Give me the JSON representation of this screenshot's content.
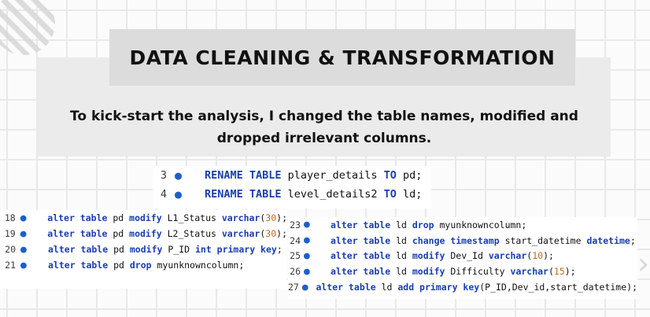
{
  "title": "DATA CLEANING & TRANSFORMATION",
  "subtitle_line1": "To kick-start the analysis, I changed the table names, modified and",
  "subtitle_line2": "dropped irrelevant columns.",
  "icons": [
    "diagonal-stripes-decoration",
    "chevron-right-icon",
    "breakpoint-dot-icon"
  ],
  "colors": {
    "keyword": "#1a3eb0",
    "number": "#c26a1c",
    "dot": "#1d5fc9",
    "panel": "#ebebeb",
    "title_box": "#dcdcdc"
  },
  "code_block_top": [
    {
      "n": "3",
      "parts": [
        {
          "t": "RENAME TABLE",
          "c": "kw"
        },
        {
          "t": " player_details ",
          "c": "tx"
        },
        {
          "t": "TO",
          "c": "kw"
        },
        {
          "t": " pd;",
          "c": "tx"
        }
      ]
    },
    {
      "n": "4",
      "parts": [
        {
          "t": "RENAME TABLE",
          "c": "kw"
        },
        {
          "t": " level_details2 ",
          "c": "tx"
        },
        {
          "t": "TO",
          "c": "kw"
        },
        {
          "t": " ld;",
          "c": "tx"
        }
      ]
    }
  ],
  "code_block_left": [
    {
      "n": "18",
      "parts": [
        {
          "t": "alter table",
          "c": "kw"
        },
        {
          "t": " pd ",
          "c": "tx"
        },
        {
          "t": "modify",
          "c": "kw"
        },
        {
          "t": " L1_Status ",
          "c": "tx"
        },
        {
          "t": "varchar",
          "c": "kw"
        },
        {
          "t": "(",
          "c": "tx"
        },
        {
          "t": "30",
          "c": "num"
        },
        {
          "t": ");",
          "c": "tx"
        }
      ]
    },
    {
      "n": "19",
      "parts": [
        {
          "t": "alter table",
          "c": "kw"
        },
        {
          "t": " pd ",
          "c": "tx"
        },
        {
          "t": "modify",
          "c": "kw"
        },
        {
          "t": " L2_Status ",
          "c": "tx"
        },
        {
          "t": "varchar",
          "c": "kw"
        },
        {
          "t": "(",
          "c": "tx"
        },
        {
          "t": "30",
          "c": "num"
        },
        {
          "t": ");",
          "c": "tx"
        }
      ]
    },
    {
      "n": "20",
      "parts": [
        {
          "t": "alter table",
          "c": "kw"
        },
        {
          "t": " pd ",
          "c": "tx"
        },
        {
          "t": "modify",
          "c": "kw"
        },
        {
          "t": " P_ID ",
          "c": "tx"
        },
        {
          "t": "int primary key",
          "c": "kw"
        },
        {
          "t": ";",
          "c": "tx"
        }
      ]
    },
    {
      "n": "21",
      "parts": [
        {
          "t": "alter table",
          "c": "kw"
        },
        {
          "t": " pd ",
          "c": "tx"
        },
        {
          "t": "drop",
          "c": "kw"
        },
        {
          "t": " myunknowncolumn;",
          "c": "tx"
        }
      ]
    }
  ],
  "code_block_right": [
    {
      "n": "23",
      "parts": [
        {
          "t": "alter table",
          "c": "kw"
        },
        {
          "t": " ld ",
          "c": "tx"
        },
        {
          "t": "drop",
          "c": "kw"
        },
        {
          "t": " myunknowncolumn;",
          "c": "tx"
        }
      ]
    },
    {
      "n": "24",
      "parts": [
        {
          "t": "alter table",
          "c": "kw"
        },
        {
          "t": " ld ",
          "c": "tx"
        },
        {
          "t": "change timestamp",
          "c": "kw"
        },
        {
          "t": " start_datetime ",
          "c": "tx"
        },
        {
          "t": "datetime",
          "c": "kw"
        },
        {
          "t": ";",
          "c": "tx"
        }
      ]
    },
    {
      "n": "25",
      "parts": [
        {
          "t": "alter table",
          "c": "kw"
        },
        {
          "t": " ld ",
          "c": "tx"
        },
        {
          "t": "modify",
          "c": "kw"
        },
        {
          "t": " Dev_Id ",
          "c": "tx"
        },
        {
          "t": "varchar",
          "c": "kw"
        },
        {
          "t": "(",
          "c": "tx"
        },
        {
          "t": "10",
          "c": "num"
        },
        {
          "t": ");",
          "c": "tx"
        }
      ]
    },
    {
      "n": "26",
      "parts": [
        {
          "t": "alter table",
          "c": "kw"
        },
        {
          "t": " ld ",
          "c": "tx"
        },
        {
          "t": "modify",
          "c": "kw"
        },
        {
          "t": " Difficulty ",
          "c": "tx"
        },
        {
          "t": "varchar",
          "c": "kw"
        },
        {
          "t": "(",
          "c": "tx"
        },
        {
          "t": "15",
          "c": "num"
        },
        {
          "t": ");",
          "c": "tx"
        }
      ]
    },
    {
      "n": "27",
      "parts": [
        {
          "t": "alter table",
          "c": "kw"
        },
        {
          "t": " ld ",
          "c": "tx"
        },
        {
          "t": "add primary key",
          "c": "kw"
        },
        {
          "t": "(P_ID,Dev_id,start_datetime);",
          "c": "tx"
        }
      ]
    }
  ]
}
